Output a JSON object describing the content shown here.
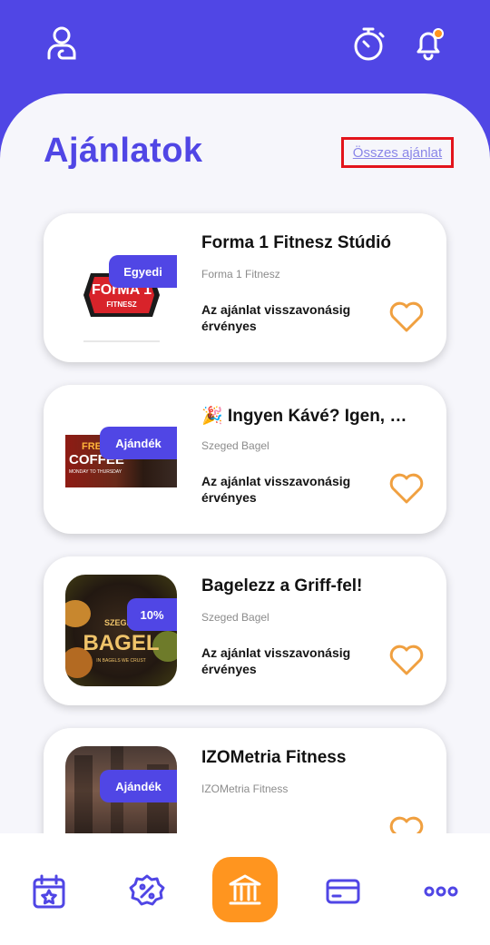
{
  "header": {
    "profile_icon": "user-icon",
    "timer_icon": "stopwatch-icon",
    "notification_icon": "bell-icon",
    "notification_dot_color": "#ff951f"
  },
  "page": {
    "title": "Ajánlatok",
    "all_offers_link": "Összes ajánlat"
  },
  "offers": [
    {
      "title": "Forma 1 Fitnesz Stúdió",
      "partner": "Forma 1 Fitnesz",
      "validity": "Az ajánlat visszavonásig érvényes",
      "badge": "Egyedi",
      "logo_text": "FOrMA 1",
      "logo_sub": "FITNESZ"
    },
    {
      "title": "🎉 Ingyen Kávé? Igen, …",
      "partner": "Szeged Bagel",
      "validity": "Az ajánlat visszavonásig érvényes",
      "badge": "Ajándék",
      "logo_text": "COFFEE",
      "logo_top": "FREE",
      "logo_sub": "MONDAY TO THURSDAY"
    },
    {
      "title": "Bagelezz a Griff-fel!",
      "partner": "Szeged Bagel",
      "validity": "Az ajánlat visszavonásig érvényes",
      "badge": "10%",
      "logo_top": "SZEGED",
      "logo_text": "BAGEL",
      "logo_sub": "IN BAGELS WE CRUST"
    },
    {
      "title": "IZOMetria Fitness",
      "partner": "IZOMetria Fitness",
      "validity": "",
      "badge": "Ajándék"
    }
  ],
  "bottom_nav": {
    "items": [
      "calendar-star-icon",
      "discount-icon",
      "bank-icon",
      "card-icon",
      "more-icon"
    ],
    "accent": "#5046e5",
    "center_color": "#ff951f"
  },
  "colors": {
    "primary": "#5046e5",
    "accent": "#ff951f",
    "highlight_border": "#e3141b"
  }
}
